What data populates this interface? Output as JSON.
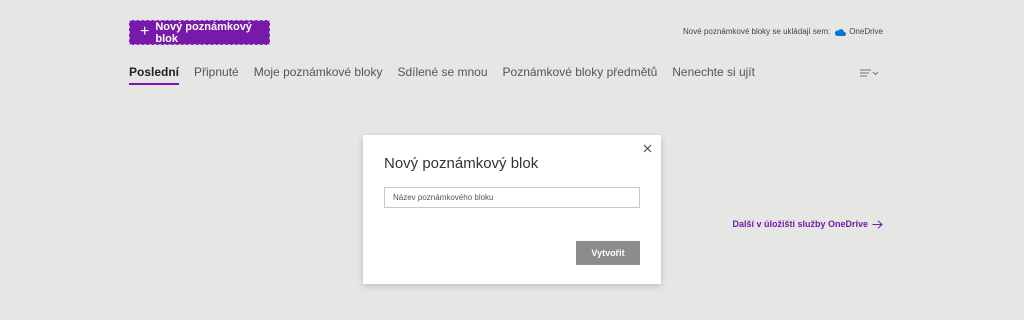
{
  "header": {
    "new_button_label": "Nový poznámkový blok",
    "save_location_text": "Nové poznámkové bloky se ukládají sem:",
    "save_location_service": "OneDrive"
  },
  "tabs": [
    {
      "label": "Poslední",
      "active": true
    },
    {
      "label": "Připnuté",
      "active": false
    },
    {
      "label": "Moje poznámkové bloky",
      "active": false
    },
    {
      "label": "Sdílené se mnou",
      "active": false
    },
    {
      "label": "Poznámkové bloky předmětů",
      "active": false
    },
    {
      "label": "Nenechte si ujít",
      "active": false
    }
  ],
  "next_link": "Další v úložišti služby OneDrive",
  "dialog": {
    "title": "Nový poznámkový blok",
    "input_placeholder": "Název poznámkového bloku",
    "input_value": "",
    "create_label": "Vytvořit"
  },
  "colors": {
    "accent": "#7719aa",
    "background": "#e6e6e5",
    "button_disabled": "#8c8c8c",
    "onedrive_blue": "#0078d4"
  },
  "icons": {
    "new_button": "plus-icon",
    "onedrive": "cloud-icon",
    "sort": "sort-list-icon",
    "next": "arrow-right-icon",
    "close": "close-icon"
  }
}
